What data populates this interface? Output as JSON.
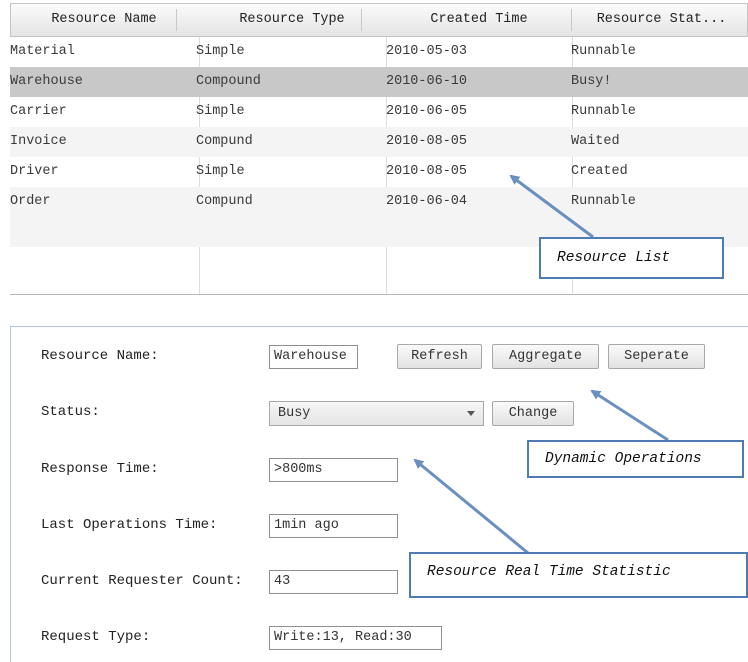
{
  "table": {
    "columns": [
      "Resource Name",
      "Resource Type",
      "Created Time",
      "Resource Stat..."
    ],
    "rows": [
      [
        "Material",
        "Simple",
        "2010-05-03",
        "Runnable"
      ],
      [
        "Warehouse",
        "Compound",
        "2010-06-10",
        "Busy!"
      ],
      [
        "Carrier",
        "Simple",
        "2010-06-05",
        "Runnable"
      ],
      [
        "Invoice",
        "Compund",
        "2010-08-05",
        "Waited"
      ],
      [
        "Driver",
        "Simple",
        "2010-08-05",
        "Created"
      ],
      [
        "Order",
        "Compund",
        "2010-06-04",
        "Runnable"
      ]
    ],
    "selected_row_index": 1
  },
  "callouts": {
    "resource_list": "Resource List",
    "dynamic_operations": "Dynamic Operations",
    "real_time_statistic": "Resource Real Time Statistic"
  },
  "panel": {
    "resource_name": {
      "label": "Resource Name:",
      "value": "Warehouse"
    },
    "buttons": {
      "refresh": "Refresh",
      "aggregate": "Aggregate",
      "seperate": "Seperate",
      "change": "Change"
    },
    "status": {
      "label": "Status:",
      "value": "Busy"
    },
    "response_time": {
      "label": "Response Time:",
      "value": ">800ms"
    },
    "last_operations_time": {
      "label": "Last Operations Time:",
      "value": "1min ago"
    },
    "current_requester_count": {
      "label": "Current Requester Count:",
      "value": "43"
    },
    "request_type": {
      "label": "Request Type:",
      "value": "Write:13, Read:30"
    }
  },
  "colors": {
    "callout_border": "#4f7bb5",
    "arrow": "#6a8fc0",
    "selected_row": "#c8c8c8"
  }
}
